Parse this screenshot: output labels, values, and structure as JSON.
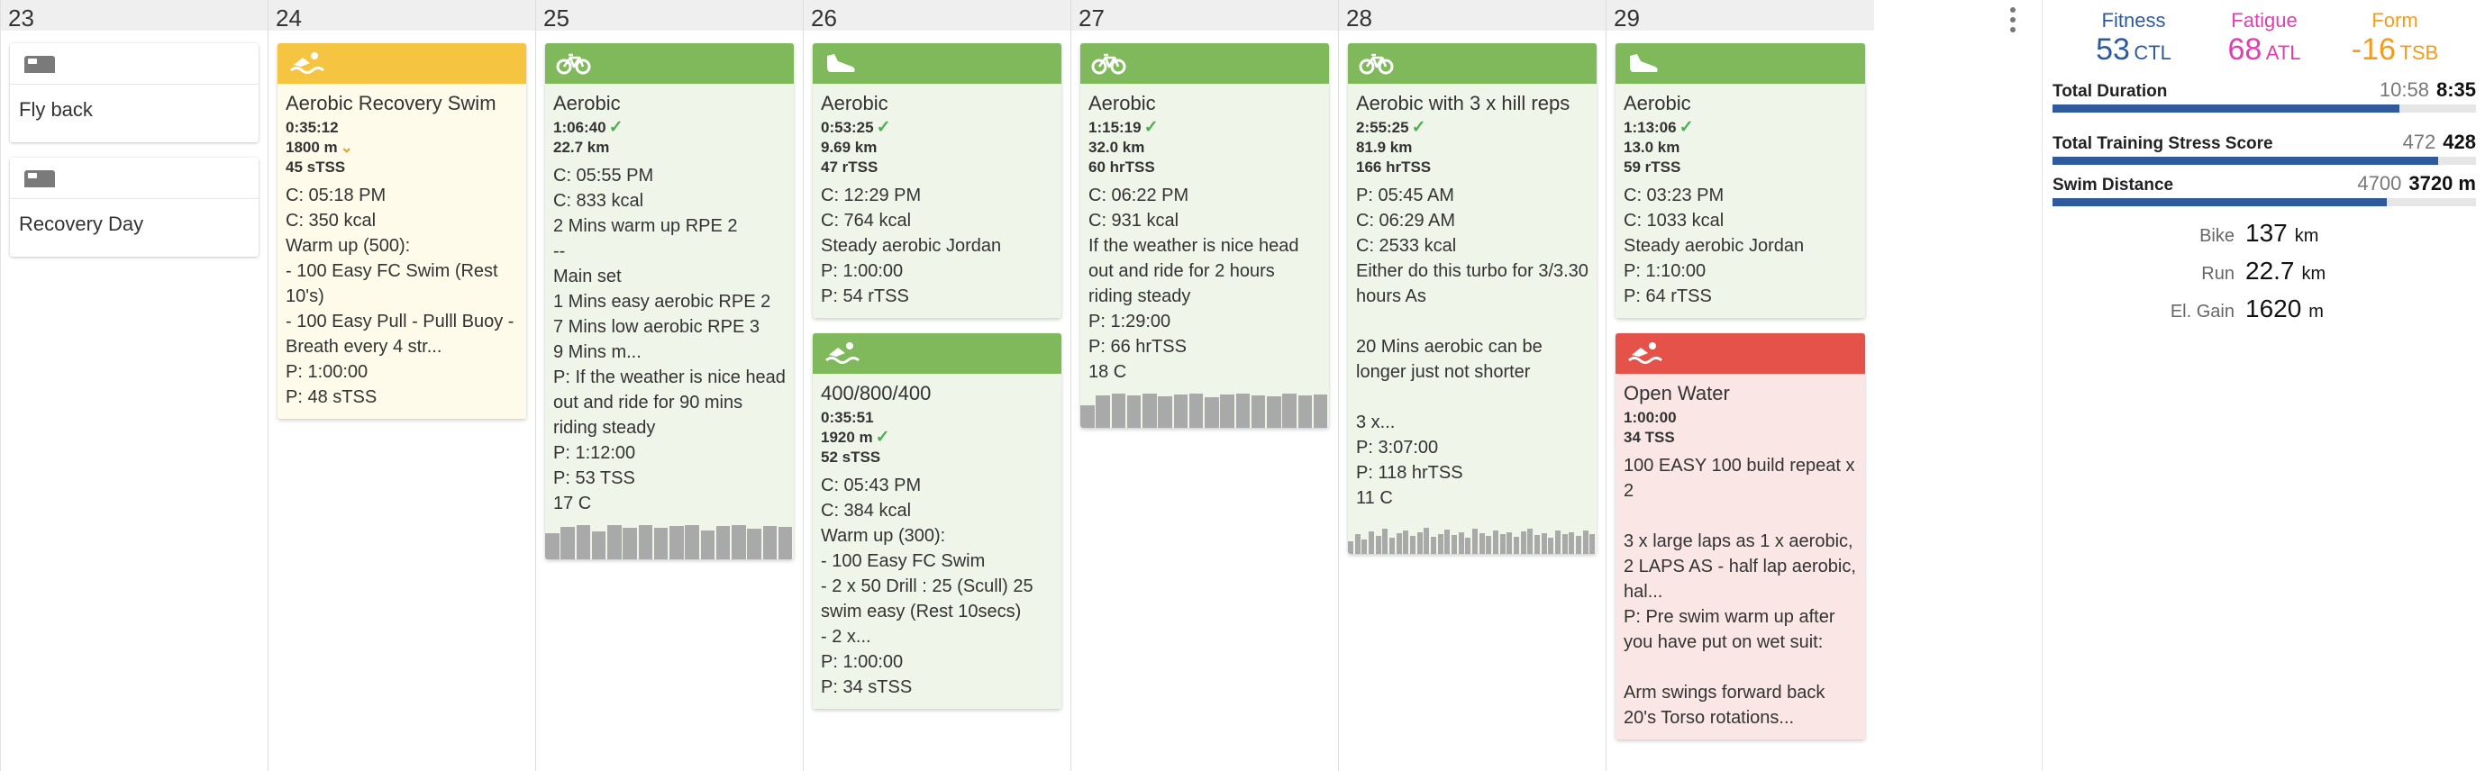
{
  "days": [
    {
      "date": "23",
      "cards": [
        {
          "kind": "note",
          "icon": "bed-icon",
          "title": "Fly back",
          "metrics": [],
          "lines": []
        },
        {
          "kind": "note",
          "icon": "bed-icon",
          "title": "Recovery Day",
          "metrics": [],
          "lines": []
        }
      ]
    },
    {
      "date": "24",
      "cards": [
        {
          "kind": "yellow",
          "icon": "swim-icon",
          "title": "Aerobic Recovery Swim",
          "metrics": [
            {
              "text": "0:35:12",
              "mark": ""
            },
            {
              "text": "1800 m",
              "mark": "chevron"
            },
            {
              "text": "45 sTSS",
              "mark": ""
            }
          ],
          "lines": [
            "C: 05:18 PM",
            "C: 350 kcal",
            "Warm up (500):",
            "- 100 Easy FC Swim (Rest 10's)",
            "- 100 Easy Pull - Pulll Buoy - Breath every 4 str...",
            "P: 1:00:00",
            "P: 48 sTSS"
          ]
        }
      ]
    },
    {
      "date": "25",
      "cards": [
        {
          "kind": "bike",
          "icon": "bike-icon",
          "title": "Aerobic",
          "metrics": [
            {
              "text": "1:06:40",
              "mark": "check"
            },
            {
              "text": "22.7 km",
              "mark": ""
            }
          ],
          "lines": [
            "C: 05:55 PM",
            "C: 833 kcal",
            "2 Mins warm up RPE 2",
            "--",
            "Main set",
            "1 Mins easy aerobic RPE 2",
            "7 Mins low aerobic RPE 3",
            "9 Mins m...",
            "P: If the weather is nice head out and ride for 90 mins riding steady",
            "P: 1:12:00",
            "P: 53 TSS",
            "17 C"
          ],
          "graph": [
            0.72,
            0.9,
            0.95,
            0.78,
            0.95,
            0.88,
            0.95,
            0.88,
            0.92,
            0.95,
            0.8,
            0.92,
            0.95,
            0.85,
            0.93,
            0.9
          ]
        }
      ]
    },
    {
      "date": "26",
      "cards": [
        {
          "kind": "run",
          "icon": "shoe-icon",
          "title": "Aerobic",
          "metrics": [
            {
              "text": "0:53:25",
              "mark": "check"
            },
            {
              "text": "9.69 km",
              "mark": ""
            },
            {
              "text": "47 rTSS",
              "mark": ""
            }
          ],
          "lines": [
            "C: 12:29 PM",
            "C: 764 kcal",
            "Steady aerobic Jordan",
            "P: 1:00:00",
            "P: 54 rTSS"
          ]
        },
        {
          "kind": "swim",
          "icon": "swim-icon",
          "title": "400/800/400",
          "metrics": [
            {
              "text": "0:35:51",
              "mark": ""
            },
            {
              "text": "1920 m",
              "mark": "check"
            },
            {
              "text": "52 sTSS",
              "mark": ""
            }
          ],
          "lines": [
            "C: 05:43 PM",
            "C: 384 kcal",
            "Warm up (300):",
            "- 100 Easy FC Swim",
            "- 2 x 50 Drill : 25 (Scull) 25 swim easy (Rest 10secs)",
            "- 2 x...",
            "P: 1:00:00",
            "P: 34 sTSS"
          ]
        }
      ]
    },
    {
      "date": "27",
      "cards": [
        {
          "kind": "bike",
          "icon": "bike-icon",
          "title": "Aerobic",
          "metrics": [
            {
              "text": "1:15:19",
              "mark": "check"
            },
            {
              "text": "32.0 km",
              "mark": ""
            },
            {
              "text": "60 hrTSS",
              "mark": ""
            }
          ],
          "lines": [
            "C: 06:22 PM",
            "C: 931 kcal",
            "If the weather is nice head out and ride for 2 hours riding steady",
            "P: 1:29:00",
            "P: 66 hrTSS",
            "18 C"
          ],
          "graph": [
            0.62,
            0.9,
            0.95,
            0.9,
            0.95,
            0.88,
            0.92,
            0.95,
            0.85,
            0.92,
            0.95,
            0.9,
            0.88,
            0.95,
            0.9,
            0.92
          ]
        }
      ]
    },
    {
      "date": "28",
      "cards": [
        {
          "kind": "bike",
          "icon": "bike-icon",
          "title": "Aerobic with 3 x hill reps",
          "metrics": [
            {
              "text": "2:55:25",
              "mark": "check"
            },
            {
              "text": "81.9 km",
              "mark": ""
            },
            {
              "text": "166 hrTSS",
              "mark": ""
            }
          ],
          "lines": [
            "P: 05:45 AM",
            "C: 06:29 AM",
            "C: 2533 kcal",
            "Either do this turbo for 3/3.30 hours As",
            "",
            "20 Mins aerobic can be longer just not shorter",
            "",
            "3 x...",
            "P: 3:07:00",
            "P: 118 hrTSS",
            "11 C"
          ],
          "graph": [
            0.35,
            0.55,
            0.4,
            0.62,
            0.5,
            0.7,
            0.45,
            0.58,
            0.66,
            0.5,
            0.6,
            0.72,
            0.48,
            0.55,
            0.68,
            0.52,
            0.6,
            0.45,
            0.7,
            0.58,
            0.5,
            0.65,
            0.55,
            0.6,
            0.48,
            0.62,
            0.7,
            0.52,
            0.58,
            0.45,
            0.66,
            0.55,
            0.6,
            0.5,
            0.64,
            0.56
          ]
        }
      ]
    },
    {
      "date": "29",
      "cards": [
        {
          "kind": "run",
          "icon": "shoe-icon",
          "title": "Aerobic",
          "metrics": [
            {
              "text": "1:13:06",
              "mark": "check"
            },
            {
              "text": "13.0 km",
              "mark": ""
            },
            {
              "text": "59 rTSS",
              "mark": ""
            }
          ],
          "lines": [
            "C: 03:23 PM",
            "C: 1033 kcal",
            "Steady aerobic Jordan",
            "P: 1:10:00",
            "P: 64 rTSS"
          ]
        },
        {
          "kind": "red",
          "icon": "swim-icon",
          "title": "Open Water",
          "metrics": [
            {
              "text": "1:00:00",
              "mark": ""
            },
            {
              "text": "34 TSS",
              "mark": ""
            }
          ],
          "lines": [
            "100 EASY 100 build repeat x 2",
            "",
            "3 x large laps as 1 x aerobic, 2 LAPS AS - half lap aerobic, hal...",
            "P: Pre swim warm up after you have put on wet suit:",
            "",
            "Arm swings forward back 20's Torso rotations..."
          ]
        }
      ]
    }
  ],
  "summary": {
    "fitness": {
      "label": "Fitness",
      "value": "53",
      "unit": "CTL",
      "color": "#2f5b9c"
    },
    "fatigue": {
      "label": "Fatigue",
      "value": "68",
      "unit": "ATL",
      "color": "#e13fb1"
    },
    "form": {
      "label": "Form",
      "value": "-16",
      "unit": "TSB",
      "color": "#f39b1b"
    },
    "rows": [
      {
        "name": "Total Duration",
        "planned": "10:58",
        "actual": "8:35",
        "progress": 0.82
      },
      {
        "name": "Total Training Stress Score",
        "planned": "472",
        "actual": "428",
        "progress": 0.91
      },
      {
        "name": "Swim Distance",
        "planned": "4700",
        "actual": "3720 m",
        "progress": 0.79
      }
    ],
    "totals": [
      {
        "label": "Bike",
        "value": "137",
        "unit": "km"
      },
      {
        "label": "Run",
        "value": "22.7",
        "unit": "km"
      },
      {
        "label": "El. Gain",
        "value": "1620",
        "unit": "m"
      }
    ]
  }
}
